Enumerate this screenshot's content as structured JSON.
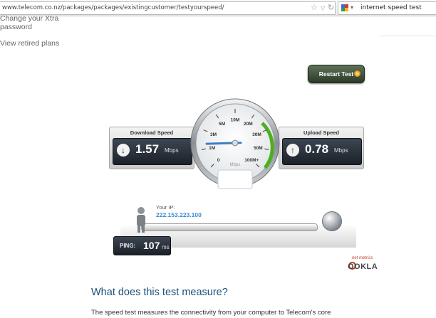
{
  "browser": {
    "url": "www.telecom.co.nz/packages/packages/existingcustomer/testyourspeed/",
    "search_query": "internet speed test",
    "icons": [
      "star-icon",
      "dropdown-icon",
      "reload-icon",
      "search-engine-icon"
    ]
  },
  "sidebar": {
    "links": [
      {
        "line1": "Change your Xtra",
        "line2": "password"
      },
      {
        "line1": "View retired plans"
      }
    ]
  },
  "speedtest": {
    "restart_label": "Restart Test",
    "download": {
      "title": "Download Speed",
      "value": "1.57",
      "unit": "Mbps"
    },
    "upload": {
      "title": "Upload Speed",
      "value": "0.78",
      "unit": "Mbps"
    },
    "gauge": {
      "unit": "Mbps",
      "ticks": [
        "0",
        "1M",
        "3M",
        "5M",
        "10M",
        "20M",
        "30M",
        "50M",
        "100M+"
      ],
      "needle_value_mbps": 1.57
    },
    "ip": {
      "label": "Your IP:",
      "value": "222.153.223.100"
    },
    "ping": {
      "label": "PING:",
      "value": "107",
      "unit": "ms"
    },
    "brand": {
      "byline": "net metrics",
      "name": "OOKLA"
    }
  },
  "article": {
    "heading": "What does this test measure?",
    "body": "The speed test measures the connectivity from your computer to Telecom's core"
  },
  "colors": {
    "heading": "#1b4f79",
    "ip": "#3a8ad1",
    "gauge_arc": "#4caf1e",
    "needle": "#3c7ec4",
    "restart_button": "#3e4d37"
  }
}
